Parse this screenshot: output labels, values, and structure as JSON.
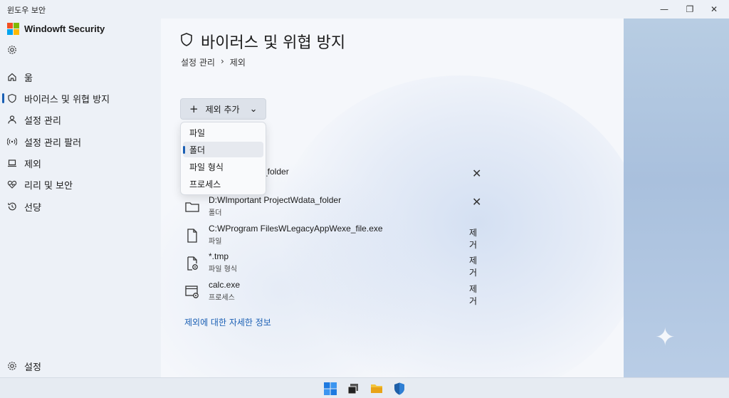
{
  "window": {
    "title": "윈도우 보안"
  },
  "window_controls": {
    "minimize": "—",
    "restore": "❐",
    "close": "✕"
  },
  "app": {
    "name": "Windowft Security"
  },
  "sidebar": {
    "items": [
      {
        "label": "욺",
        "icon": "home-icon"
      },
      {
        "label": "바이러스 및 위협 방지",
        "icon": "shield-icon",
        "active": true
      },
      {
        "label": "설정 관리",
        "icon": "person-icon"
      },
      {
        "label": "설정 관리 팔러",
        "icon": "wifi-icon"
      },
      {
        "label": "제외",
        "icon": "laptop-icon"
      },
      {
        "label": "리리 및 보안",
        "icon": "heartbeat-icon"
      },
      {
        "label": "선댱",
        "icon": "history-icon"
      }
    ],
    "settings_label": "설정"
  },
  "main": {
    "title": "바이러스 및 위협 방지",
    "breadcrumb": {
      "parent": "설정 관리",
      "sep": "›",
      "current": "제외"
    },
    "add_button": {
      "plus": "+",
      "label": "제외 추가",
      "chevron": "⌄"
    },
    "dropdown": {
      "items": [
        {
          "label": "파일"
        },
        {
          "label": "폴더",
          "selected": true
        },
        {
          "label": "파일 형식"
        },
        {
          "label": "프로세스"
        }
      ]
    },
    "exclusions": [
      {
        "path": "_folder",
        "kind": "",
        "action": "",
        "removable_x": true,
        "icon": "folder-icon"
      },
      {
        "path": "D:WImportant ProjectWdata_folder",
        "kind": "폴더",
        "action": "",
        "removable_x": true,
        "icon": "folder-icon"
      },
      {
        "path": "C:WProgram FilesWLegacyAppWexe_file.exe",
        "kind": "파일",
        "action": "제거",
        "icon": "file-icon"
      },
      {
        "path": "*.tmp",
        "kind": "파일 형식",
        "action": "제거",
        "icon": "file-type-icon"
      },
      {
        "path": "calc.exe",
        "kind": "프로세스",
        "action": "제거",
        "icon": "process-icon"
      }
    ],
    "more_link": "제외에 대한 자세한 정보"
  },
  "colors": {
    "accent": "#1a5fb4",
    "logo": [
      "#f25022",
      "#7fba00",
      "#00a4ef",
      "#ffb900"
    ]
  }
}
